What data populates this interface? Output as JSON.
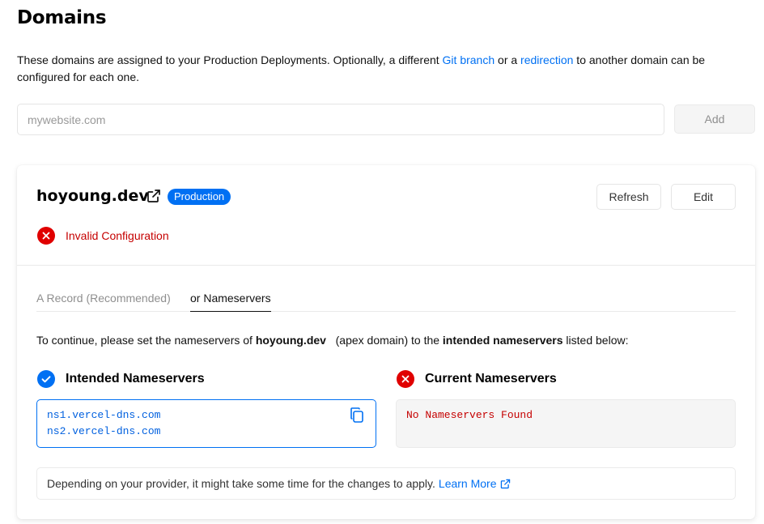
{
  "page": {
    "title": "Domains",
    "intro_prefix": "These domains are assigned to your Production Deployments. Optionally, a different ",
    "intro_link_git": "Git branch",
    "intro_middle": " or a ",
    "intro_link_redirect": "redirection",
    "intro_suffix": " to another domain can be configured for each one."
  },
  "add_domain": {
    "placeholder": "mywebsite.com",
    "value": "",
    "button_label": "Add"
  },
  "domain_card": {
    "name": "hoyoung.dev",
    "badge": "Production",
    "refresh_label": "Refresh",
    "edit_label": "Edit",
    "status_text": "Invalid Configuration",
    "tabs": [
      {
        "label": "A Record (Recommended)",
        "active": false
      },
      {
        "label": "or Nameservers",
        "active": true
      }
    ],
    "instruction": {
      "prefix": "To continue, please set the nameservers of ",
      "domain": "hoyoung.dev",
      "middle": "   (apex domain) to the ",
      "emphasis": "intended nameservers",
      "suffix": " listed below:"
    },
    "intended": {
      "title": "Intended Nameservers",
      "servers": [
        "ns1.vercel-dns.com",
        "ns2.vercel-dns.com"
      ]
    },
    "current": {
      "title": "Current Nameservers",
      "message": "No Nameservers Found"
    },
    "note": {
      "text": "Depending on your provider, it might take some time for the changes to apply.",
      "link": "Learn More"
    }
  },
  "colors": {
    "accent": "#0070f3",
    "error": "#e00000",
    "error_text": "#c50000",
    "border": "#eaeaea"
  },
  "icons": {
    "external_link": "external-link-icon",
    "error": "x-circle-icon",
    "success": "check-circle-icon",
    "copy": "copy-icon"
  }
}
